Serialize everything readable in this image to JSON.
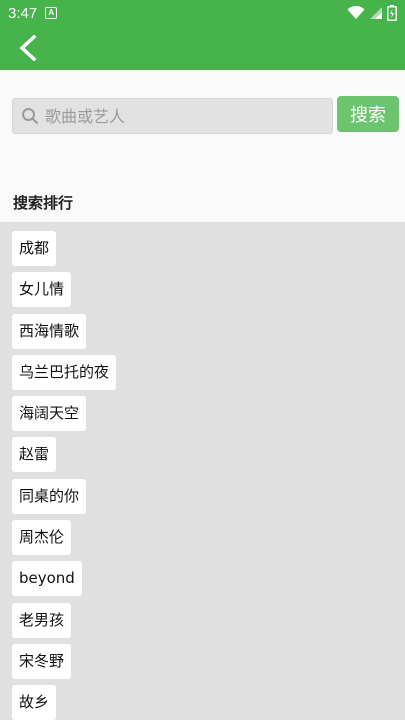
{
  "status_bar": {
    "time": "3:47",
    "notification_icon": "A"
  },
  "header": {
    "back_icon": "chevron-left-icon"
  },
  "search": {
    "placeholder": "歌曲或艺人",
    "value": "",
    "button_label": "搜索"
  },
  "ranking": {
    "title": "搜索排行",
    "items": [
      "成都",
      "女儿情",
      "西海情歌",
      "乌兰巴托的夜",
      "海阔天空",
      "赵雷",
      "同桌的你",
      "周杰伦",
      "beyond",
      "老男孩",
      "宋冬野",
      "故乡"
    ]
  },
  "colors": {
    "primary": "#46b34b",
    "search_button": "#6cc46f",
    "list_background": "#e0e0e0"
  }
}
